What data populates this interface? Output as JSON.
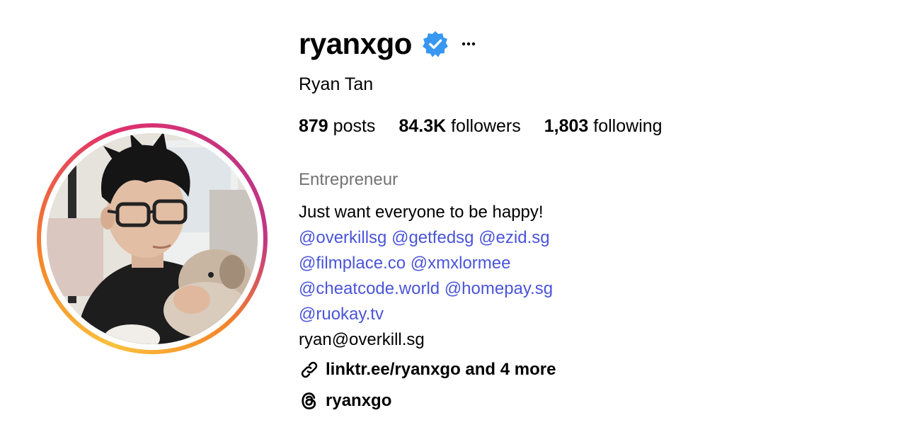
{
  "profile": {
    "username": "ryanxgo",
    "full_name": "Ryan Tan",
    "verified_icon": "verified-badge-icon",
    "more_icon": "ellipsis-icon",
    "avatar_ring_colors": [
      "#f9c23c",
      "#f58529",
      "#e1306c",
      "#c13584"
    ]
  },
  "stats": {
    "posts_count": "879",
    "posts_label": "posts",
    "followers_count": "84.3K",
    "followers_label": "followers",
    "following_count": "1,803",
    "following_label": "following"
  },
  "bio": {
    "category": "Entrepreneur",
    "text": "Just want everyone to be happy!",
    "mention_color": "#4a55d9",
    "mentions": [
      [
        "@overkillsg",
        "@getfedsg",
        "@ezid.sg"
      ],
      [
        "@filmplace.co",
        "@xmxlormee"
      ],
      [
        "@cheatcode.world",
        "@homepay.sg"
      ],
      [
        "@ruokay.tv"
      ]
    ],
    "email": "ryan@overkill.sg"
  },
  "links": {
    "link_icon": "link-icon",
    "link_text": "linktr.ee/ryanxgo and 4 more",
    "threads_icon": "threads-icon",
    "threads_text": "ryanxgo"
  }
}
